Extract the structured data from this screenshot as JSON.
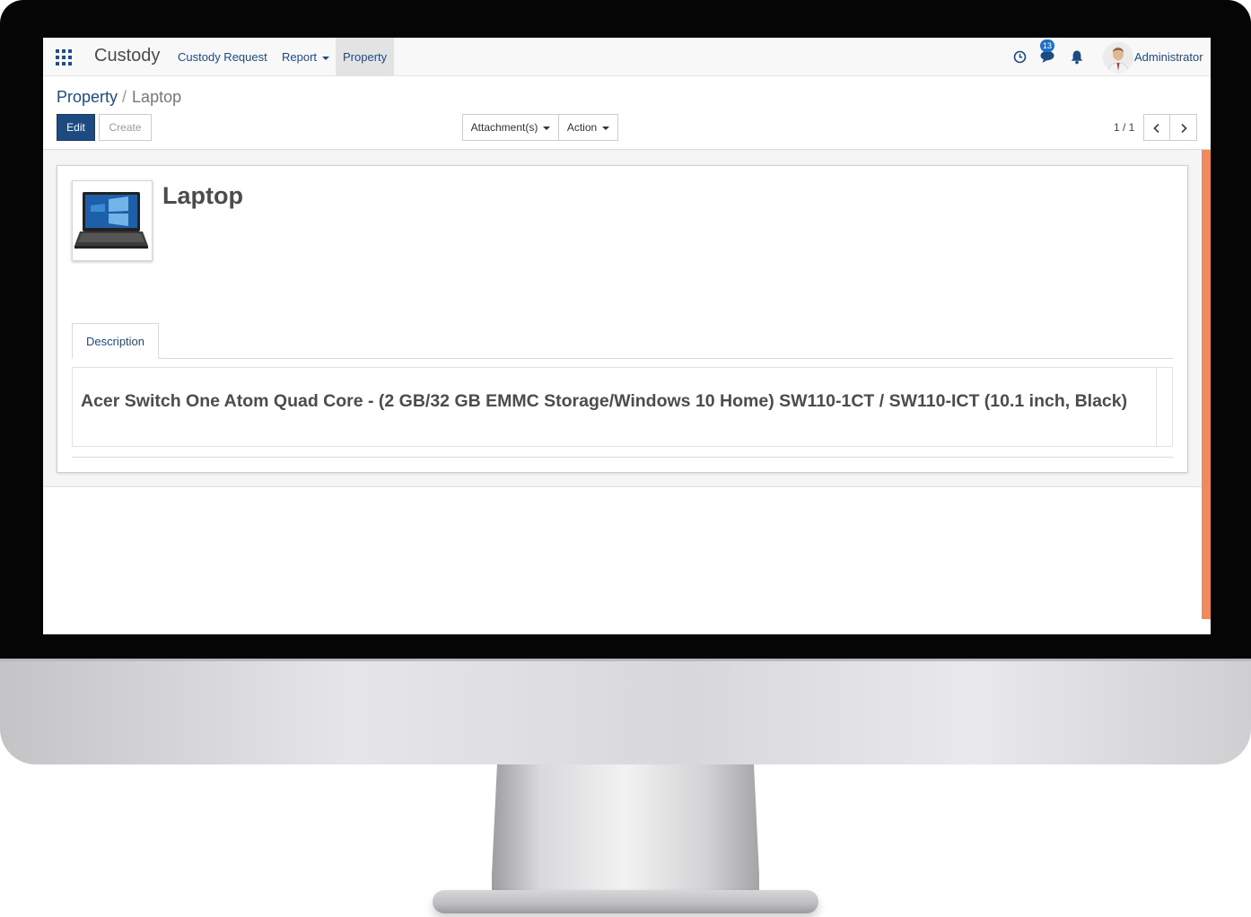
{
  "topbar": {
    "app_title": "Custody",
    "menu": [
      {
        "label": "Custody Request"
      },
      {
        "label": "Report"
      },
      {
        "label": "Property"
      }
    ],
    "chat_badge": "13",
    "user_name": "Administrator"
  },
  "breadcrumb": {
    "parent": "Property",
    "separator": "/",
    "current": "Laptop"
  },
  "buttons": {
    "edit": "Edit",
    "create": "Create",
    "attachments": "Attachment(s)",
    "action": "Action"
  },
  "pager": {
    "text": "1 / 1"
  },
  "record": {
    "name": "Laptop",
    "tab_label": "Description",
    "description": "Acer Switch One Atom Quad Core - (2 GB/32 GB EMMC Storage/Windows 10 Home) SW110-1CT / SW110-ICT  (10.1 inch, Black)"
  },
  "colors": {
    "accent": "#1e4a82",
    "scroll_accent": "#f08a5d",
    "badge": "#1e6fc9"
  }
}
